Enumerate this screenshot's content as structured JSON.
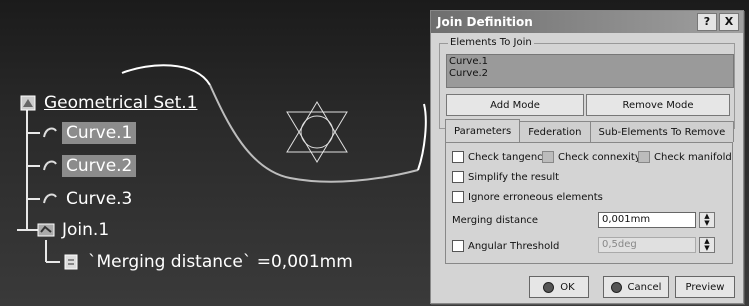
{
  "tree": {
    "root": "Geometrical Set.1",
    "curves": [
      "Curve.1",
      "Curve.2",
      "Curve.3"
    ],
    "join": "Join.1",
    "parameter": "`Merging distance` =0,001mm"
  },
  "dialog": {
    "title": "Join Definition",
    "help_label": "?",
    "close_label": "X",
    "elements_label": "Elements To Join",
    "elements": [
      "Curve.1",
      "Curve.2"
    ],
    "add_mode": "Add Mode",
    "remove_mode": "Remove Mode",
    "tabs": [
      "Parameters",
      "Federation",
      "Sub-Elements To Remove"
    ],
    "check_tangency": "Check tangency",
    "check_connexity": "Check connexity",
    "check_manifold": "Check manifold",
    "simplify": "Simplify the result",
    "ignore": "Ignore erroneous elements",
    "merging_label": "Merging distance",
    "merging_value": "0,001mm",
    "angular_label": "Angular Threshold",
    "angular_value": "0,5deg",
    "ok": "OK",
    "cancel": "Cancel",
    "preview": "Preview"
  }
}
